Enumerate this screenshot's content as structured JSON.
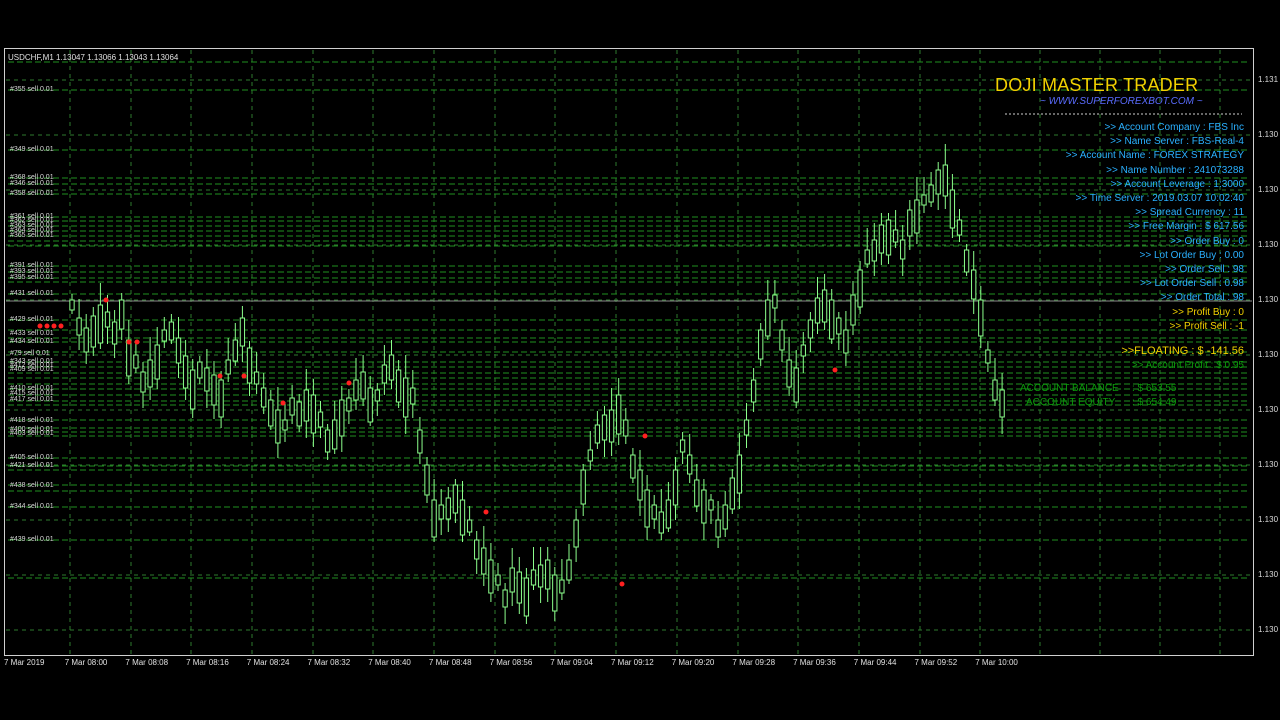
{
  "ohlc_text": "USDCHF,M1 1.13047 1.13066 1.13043 1.13064",
  "ea": {
    "title": "DOJI MASTER TRADER",
    "site": "~ WWW.SUPERFOREXBOT.COM ~",
    "lines": [
      {
        "text": ">> Account Company  : FBS Inc",
        "color": "#2ab0ff"
      },
      {
        "text": ">> Name Server  : FBS-Real-4",
        "color": "#2ab0ff"
      },
      {
        "text": ">> Account Name  : FOREX STRATEGY",
        "color": "#2ab0ff"
      },
      {
        "text": ">> Name Number  : 241073288",
        "color": "#2ab0ff"
      },
      {
        "text": ">> Account Leverage  : 1:3000",
        "color": "#2ab0ff"
      },
      {
        "text": ">> Time Server  : 2019.03.07 10:02:40",
        "color": "#2ab0ff"
      },
      {
        "text": ">> Spread Currency  : 11",
        "color": "#2ab0ff"
      },
      {
        "text": ">> Free Margin  : $ 617.56",
        "color": "#2ab0ff"
      },
      {
        "text": ">> Order Buy  : 0",
        "color": "#2ab0ff"
      },
      {
        "text": ">> Lot Order Buy  : 0.00",
        "color": "#2ab0ff"
      },
      {
        "text": ">> Order Sell  : 98",
        "color": "#2ab0ff"
      },
      {
        "text": ">> Lot Order Sell  : 0.98",
        "color": "#2ab0ff"
      },
      {
        "text": ">> Order Total  : 98",
        "color": "#2ab0ff"
      },
      {
        "text": ">> Profit Buy  : 0",
        "color": "#f2d100"
      },
      {
        "text": ">> Profit Sell  : -1",
        "color": "#f2d100"
      }
    ],
    "floating": ">>FLOATING  : $ -141.56",
    "account_profit": ">> Account Profit  : $ 0.95",
    "balance_label": "ACCOUNT BALANCE",
    "balance_value": ":     $     653.55",
    "equity_label": "ACCOUNT EQUITY",
    "equity_value": ":     $     654.49"
  },
  "order_labels": [
    "#355 sell 0.01",
    "#349 sell 0.01",
    "#368 sell 0.01",
    "#346 sell 0.01",
    "#358 sell 0.01",
    "#361 sell 0.01",
    "#362 sell 0.01",
    "#363 sell 0.01",
    "#364 sell 0.01",
    "#365 sell 0.01",
    "#391 sell 0.01",
    "#393 sell 0.01",
    "#395 sell 0.01",
    "#431 sell 0.01",
    "#429 sell 0.01",
    "#433 sell 0.01",
    "#434 sell 0.01",
    "#79 sell 0.01",
    "#343 sell 0.01",
    "#412 sell 0.01",
    "#409 sell 0.01",
    "#410 sell 0.01",
    "#415 sell 0.01",
    "#417 sell 0.01",
    "#418 sell 0.01",
    "#400 sell 0.01",
    "#403 sell 0.01",
    "#405 sell 0.01",
    "#421 sell 0.01",
    "#438 sell 0.01",
    "#344 sell 0.01",
    "#439 sell 0.01"
  ],
  "price_axis": [
    "1.131",
    "1.130",
    "1.130",
    "1.130",
    "1.130",
    "1.130",
    "1.130",
    "1.130",
    "1.130",
    "1.130",
    "1.130"
  ],
  "time_axis": [
    "7 Mar 2019",
    "7 Mar 08:00",
    "7 Mar 08:08",
    "7 Mar 08:16",
    "7 Mar 08:24",
    "7 Mar 08:32",
    "7 Mar 08:40",
    "7 Mar 08:48",
    "7 Mar 08:56",
    "7 Mar 09:04",
    "7 Mar 09:12",
    "7 Mar 09:20",
    "7 Mar 09:28",
    "7 Mar 09:36",
    "7 Mar 09:44",
    "7 Mar 09:52",
    "7 Mar 10:00"
  ],
  "colors": {
    "bull": "#8cff8c",
    "grid": "#2e7a2e",
    "order_line": "#1f8f1f",
    "text": "#d8d8d8"
  }
}
